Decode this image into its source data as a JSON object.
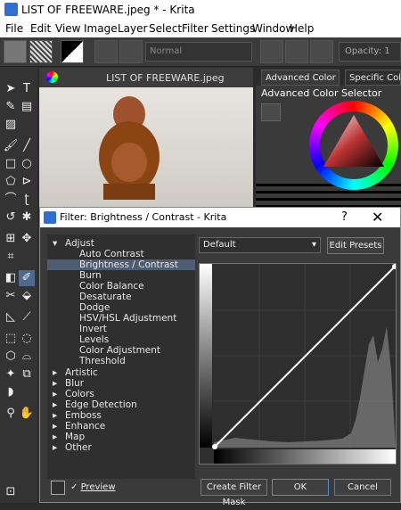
{
  "window": {
    "title": "LIST OF FREEWARE.jpeg * - Krita"
  },
  "menu": [
    "File",
    "Edit",
    "View",
    "Image",
    "Layer",
    "Select",
    "Filter",
    "Settings",
    "Window",
    "Help"
  ],
  "toolbar": {
    "blend_mode": "Normal",
    "opacity_label": "Opacity: 1"
  },
  "canvas": {
    "tab_title": "LIST OF FREEWARE.jpeg"
  },
  "docker": {
    "tabs": [
      "Advanced Color S...",
      "Specific Color"
    ],
    "title": "Advanced Color Selector"
  },
  "dialog": {
    "title": "Filter: Brightness / Contrast - Krita",
    "help": "?",
    "close": "✕",
    "preset": "Default",
    "edit_presets": "Edit Presets",
    "create_filter_mask": "Create Filter Mask",
    "ok": "OK",
    "cancel": "Cancel",
    "preview": "Preview",
    "tree": {
      "adjust": "Adjust",
      "adjust_items": [
        "Auto Contrast",
        "Brightness / Contrast",
        "Burn",
        "Color Balance",
        "Desaturate",
        "Dodge",
        "HSV/HSL Adjustment",
        "Invert",
        "Levels",
        "Color Adjustment",
        "Threshold"
      ],
      "categories": [
        "Artistic",
        "Blur",
        "Colors",
        "Edge Detection",
        "Emboss",
        "Enhance",
        "Map",
        "Other"
      ]
    }
  }
}
